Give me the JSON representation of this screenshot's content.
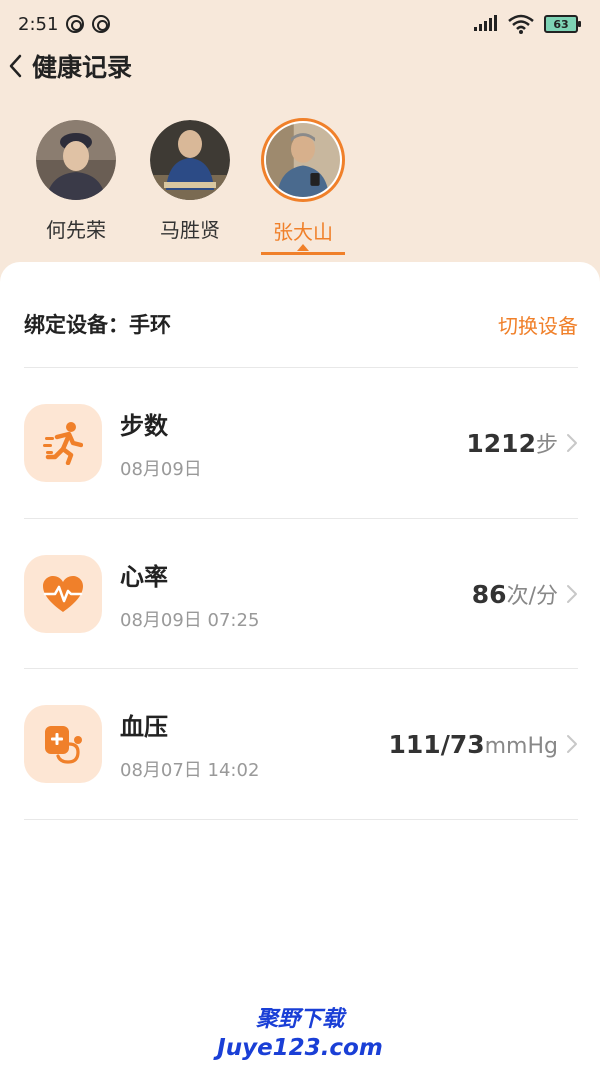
{
  "status_bar": {
    "time": "2:51",
    "battery": "63"
  },
  "nav": {
    "title": "健康记录"
  },
  "members": [
    {
      "name": "何先荣",
      "active": false
    },
    {
      "name": "马胜贤",
      "active": false
    },
    {
      "name": "张大山",
      "active": true
    }
  ],
  "device": {
    "label": "绑定设备：手环",
    "switch_label": "切换设备"
  },
  "metrics": [
    {
      "name": "步数",
      "date": "08月09日",
      "value": "1212",
      "unit": "步",
      "icon": "running-icon"
    },
    {
      "name": "心率",
      "date": "08月09日 07:25",
      "value": "86",
      "unit": "次/分",
      "icon": "heart-rate-icon"
    },
    {
      "name": "血压",
      "date": "08月07日 14:02",
      "value": "111/73",
      "unit": "mmHg",
      "icon": "blood-pressure-icon"
    }
  ],
  "colors": {
    "accent": "#f0802a",
    "header_bg": "#f7e8da",
    "icon_bg": "#fde6d4"
  },
  "watermark": {
    "line1": "聚野下载",
    "line2": "Juye123.com"
  }
}
